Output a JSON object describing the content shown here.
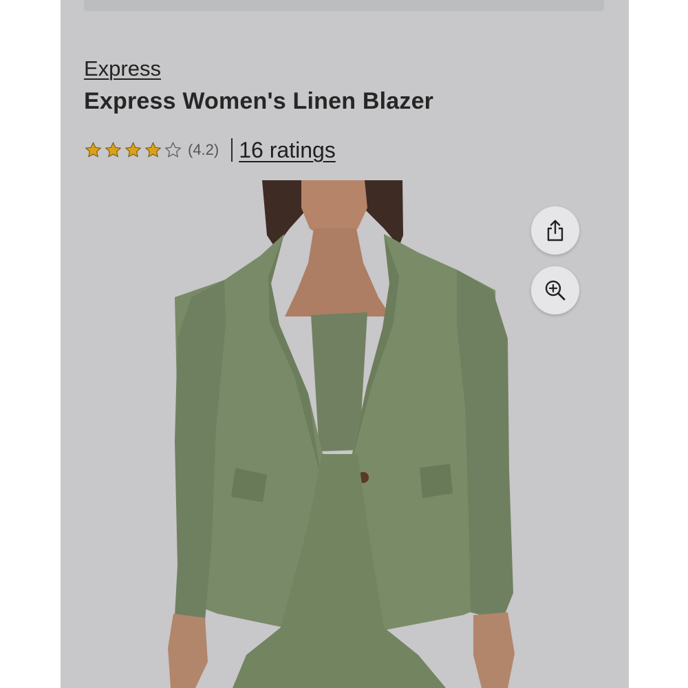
{
  "product": {
    "brand": "Express",
    "title": "Express Women's Linen Blazer",
    "rating": {
      "stars_filled": 4,
      "stars_total": 5,
      "value_text": "(4.2)",
      "count_text": "16 ratings"
    },
    "image_description_colors": {
      "blazer": "#7d8d6c",
      "skin": "#b9876a"
    }
  },
  "actions": {
    "share_icon": "share-icon",
    "zoom_icon": "zoom-in-icon"
  },
  "colors": {
    "star_gold": "#d9a21b",
    "page_background": "#c8c7c9",
    "text": "#262626"
  }
}
